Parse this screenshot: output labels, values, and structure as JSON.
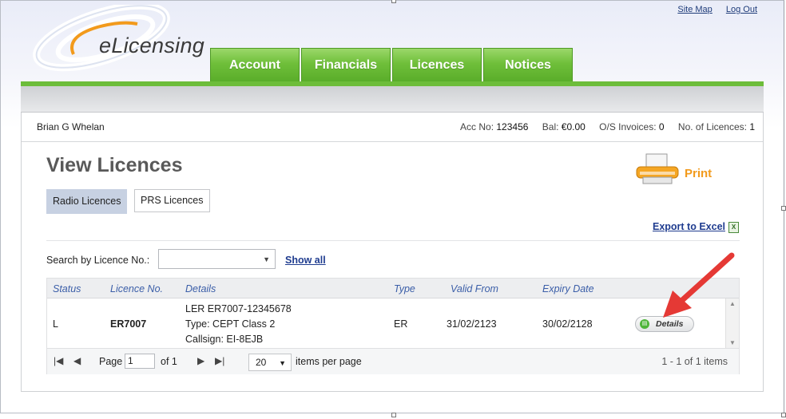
{
  "top_links": {
    "site_map": "Site Map",
    "log_out": "Log Out"
  },
  "logo": {
    "text": "eLicensing"
  },
  "nav": {
    "tabs": [
      "Account",
      "Financials",
      "Licences",
      "Notices"
    ]
  },
  "user_bar": {
    "name": "Brian G Whelan",
    "acc_label": "Acc No:",
    "acc_value": "123456",
    "bal_label": "Bal:",
    "bal_value": "€0.00",
    "invoices_label": "O/S Invoices:",
    "invoices_value": "0",
    "licences_label": "No. of Licences:",
    "licences_value": "1"
  },
  "page": {
    "title": "View Licences",
    "filter_buttons": [
      "Radio Licences",
      "PRS Licences"
    ],
    "print_label": "Print",
    "export_label": "Export to Excel"
  },
  "search": {
    "label": "Search by Licence No.:",
    "value": "",
    "show_all": "Show all"
  },
  "table": {
    "headers": [
      "Status",
      "Licence No.",
      "Details",
      "Type",
      "Valid From",
      "Expiry Date"
    ],
    "rows": [
      {
        "status": "L",
        "licence_no": "ER7007",
        "details": [
          "LER ER7007-12345678",
          "Type: CEPT Class 2",
          "Callsign: EI-8EJB"
        ],
        "type": "ER",
        "valid_from": "31/02/2123",
        "expiry_date": "30/02/2128",
        "action": "Details"
      }
    ]
  },
  "pager": {
    "page_label": "Page",
    "page_value": "1",
    "of_label": "of 1",
    "page_size": "20",
    "items_per_page_label": "items per page",
    "summary": "1 - 1 of 1 items"
  },
  "colors": {
    "tab_green": "#6fbf3a",
    "print_orange": "#f29a1c",
    "link_blue": "#1f3c8f",
    "annotation_arrow": "#e53935"
  }
}
